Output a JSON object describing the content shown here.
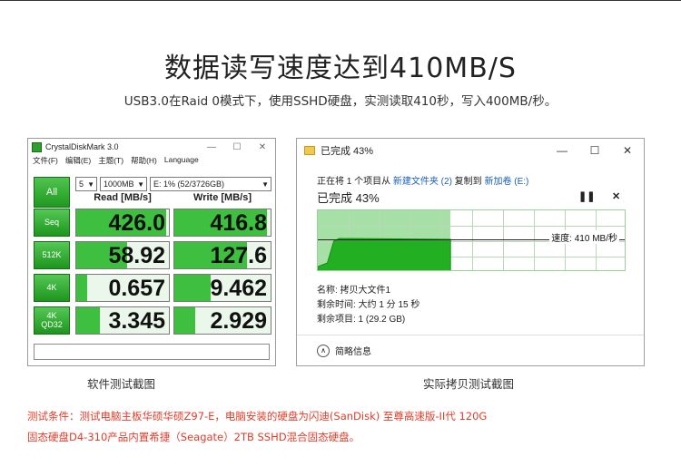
{
  "headline": "数据读写速度达到410MB/S",
  "subline": "USB3.0在Raid 0模式下，使用SSHD硬盘，实测读取410秒，写入400MB/秒。",
  "cdm": {
    "title": "CrystalDiskMark 3.0",
    "menu": [
      "文件(F)",
      "编辑(E)",
      "主题(T)",
      "帮助(H)",
      "Language"
    ],
    "all_label": "All",
    "count_value": "5",
    "size_value": "1000MB",
    "drive_value": "E: 1% (52/3726GB)",
    "read_header": "Read [MB/s]",
    "write_header": "Write [MB/s]",
    "rows": [
      {
        "label1": "Seq",
        "label2": "",
        "read": "426.0",
        "write": "416.8",
        "read_pct": 0.97,
        "write_pct": 0.96
      },
      {
        "label1": "512K",
        "label2": "",
        "read": "58.92",
        "write": "127.6",
        "read_pct": 0.55,
        "write_pct": 0.75
      },
      {
        "label1": "4K",
        "label2": "",
        "read": "0.657",
        "write": "9.462",
        "read_pct": 0.12,
        "write_pct": 0.38
      },
      {
        "label1": "4K",
        "label2": "QD32",
        "read": "3.345",
        "write": "2.929",
        "read_pct": 0.25,
        "write_pct": 0.22
      }
    ]
  },
  "copy": {
    "title": "已完成 43%",
    "line_prefix": "正在将 1 个项目从 ",
    "source": "新建文件夹 (2)",
    "line_mid": " 复制到 ",
    "dest": "新加卷 (E:)",
    "percent_text": "已完成 43%",
    "progress": 0.43,
    "speed": "速度: 410 MB/秒",
    "name_line": "名称: 拷贝大文件1",
    "time_line": "剩余时间: 大约 1 分 15 秒",
    "items_line": "剩余项目: 1 (29.2 GB)",
    "more_label": "简略信息"
  },
  "captions": {
    "left": "软件测试截图",
    "right": "实际拷贝测试截图"
  },
  "notes": {
    "line1": "测试条件：测试电脑主板华硕华硕Z97-E，电脑安装的硬盘为闪迪(SanDisk) 至尊高速版-II代 120G",
    "line2": "固态硬盘D4-310产品内置希捷（Seagate）2TB  SSHD混合固态硬盘。"
  },
  "colors": {
    "accent_green": "#3fbf3f",
    "note_red": "#e03c2a",
    "link_blue": "#1a5fb4"
  }
}
